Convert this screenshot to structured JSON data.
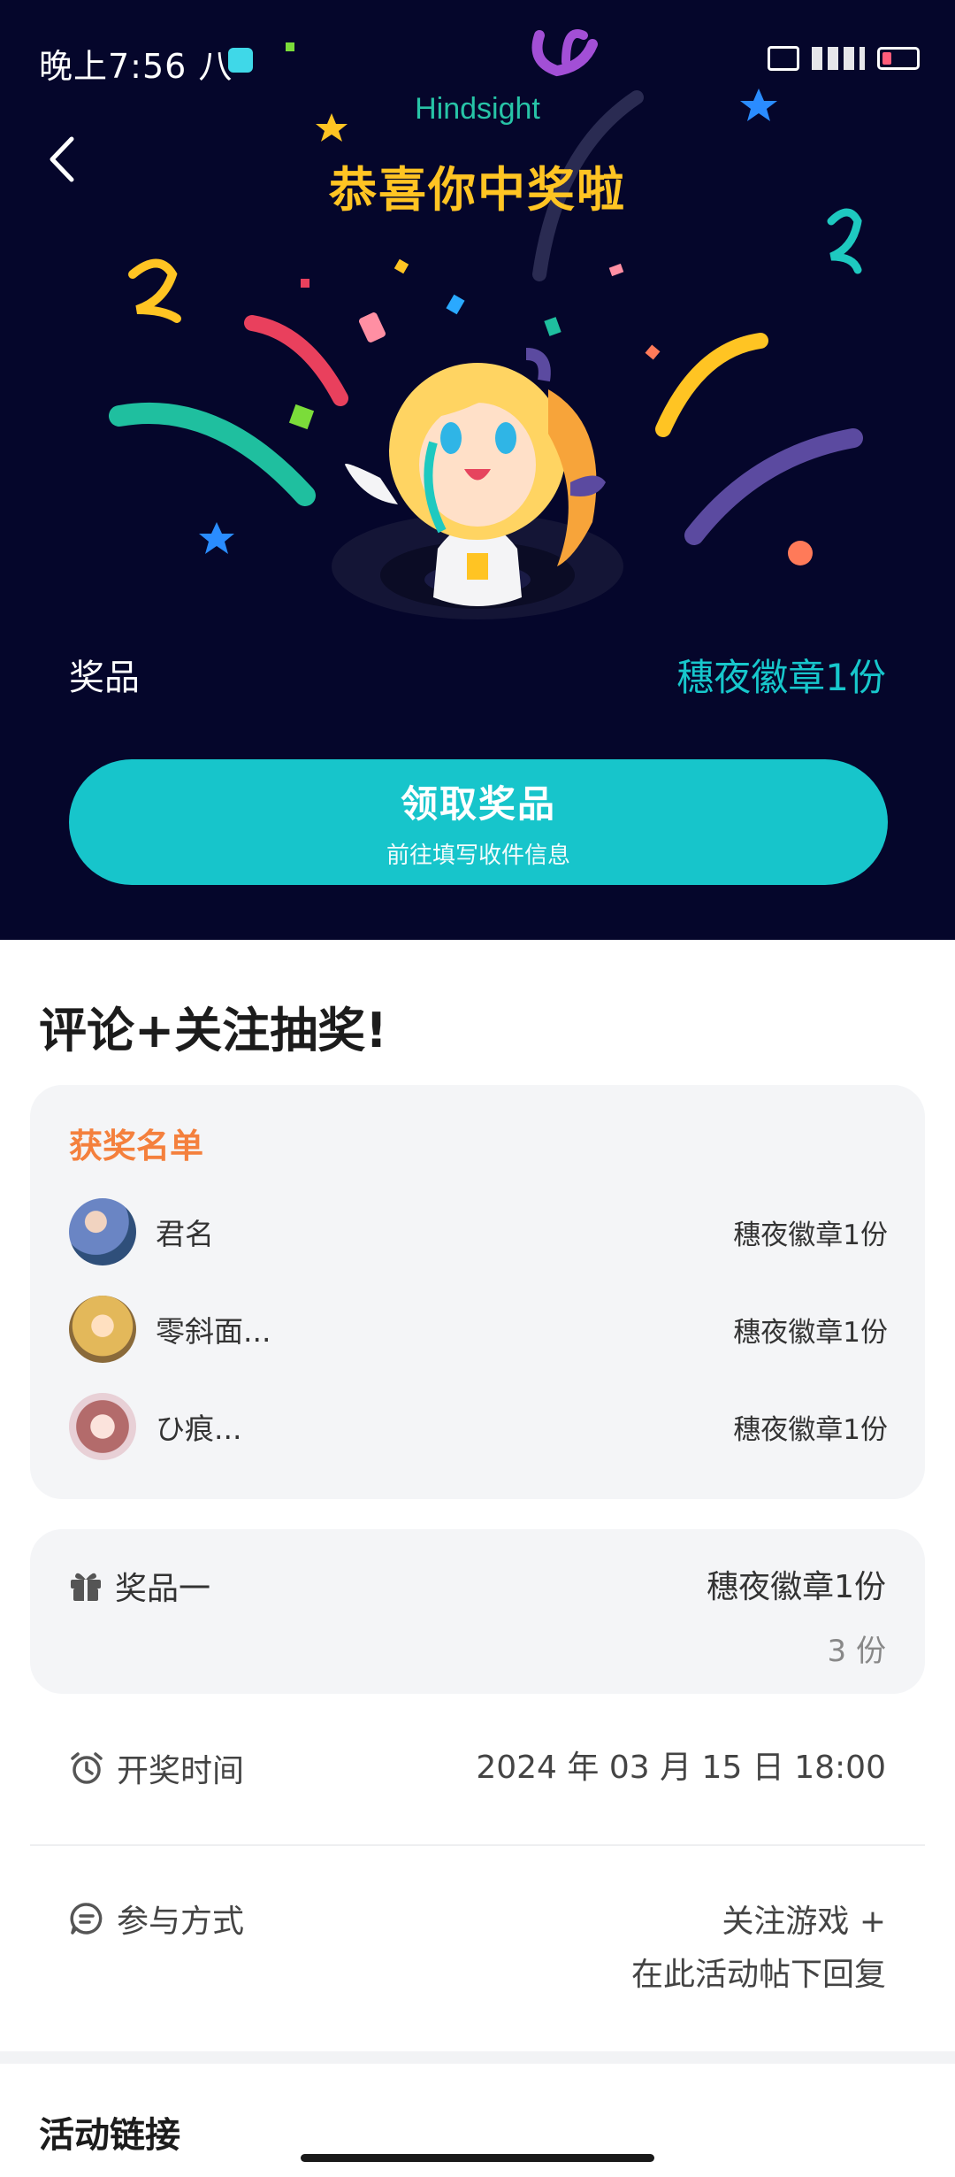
{
  "status_bar": {
    "time": "晚上7:56 八"
  },
  "hero": {
    "brand": "Hindsight",
    "congrats": "恭喜你中奖啦",
    "prize_label": "奖品",
    "prize_value": "穗夜徽章1份",
    "claim_button": "领取奖品",
    "claim_subtitle": "前往填写收件信息"
  },
  "event": {
    "title": "评论+关注抽奖!"
  },
  "winners": {
    "title": "获奖名单",
    "items": [
      {
        "name": "君名",
        "prize": "穗夜徽章1份",
        "avatar_color": "#5f8fcf"
      },
      {
        "name": "零斜面...",
        "prize": "穗夜徽章1份",
        "avatar_color": "#e3c172"
      },
      {
        "name": "ひ痕...",
        "prize": "穗夜徽章1份",
        "avatar_color": "#c48f9c"
      }
    ]
  },
  "prize_card": {
    "label": "奖品一",
    "name": "穗夜徽章1份",
    "quantity": "3 份"
  },
  "draw_time": {
    "label": "开奖时间",
    "value": "2024 年 03 月 15 日 18:00"
  },
  "participation": {
    "label": "参与方式",
    "line1": "关注游戏 +",
    "line2": "在此活动帖下回复"
  },
  "activity_link": {
    "title": "活动链接"
  },
  "colors": {
    "hero_bg": "#05062b",
    "accent": "#17c5cb",
    "congrats": "#ffc423",
    "winners_title": "#f4803d"
  }
}
